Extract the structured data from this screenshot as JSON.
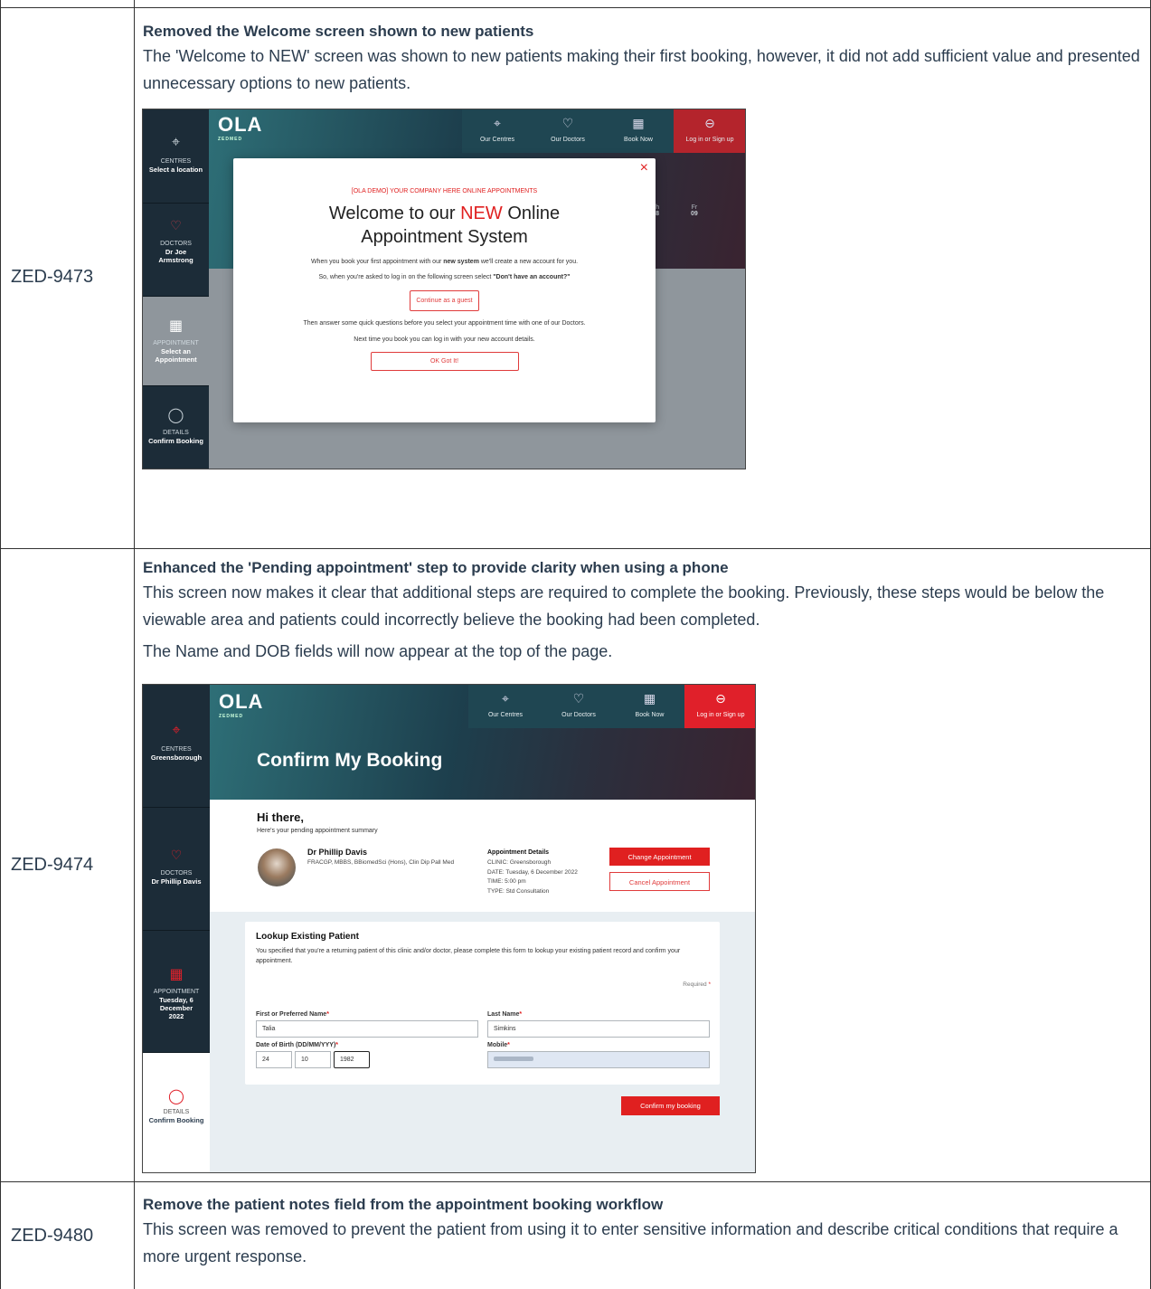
{
  "rows": [
    {
      "ticket": "ZED-9473",
      "heading": "Removed the Welcome screen shown to new patients",
      "paragraphs": [
        "The 'Welcome to NEW' screen was shown to new patients making their first booking, however, it did not add sufficient value and presented unnecessary options to new patients."
      ]
    },
    {
      "ticket": "ZED-9474",
      "heading": "Enhanced the 'Pending appointment' step to provide clarity when using a phone",
      "paragraphs": [
        "This screen now makes it clear that additional steps are required to complete the booking. Previously, these steps would be below the viewable area and patients could incorrectly believe the booking had been completed.",
        "The Name and DOB fields will now appear at the top of the page."
      ]
    },
    {
      "ticket": "ZED-9480",
      "heading": "Remove the patient notes field from the appointment booking workflow",
      "paragraphs": [
        "This screen was removed to prevent the patient from using it to enter sensitive information and describe critical conditions that require a more urgent response."
      ]
    }
  ],
  "shot1": {
    "logo": "OLA",
    "logo_sub": "ZEDMED",
    "nav": [
      "Our Centres",
      "Our Doctors",
      "Book Now",
      "Log in or Sign up"
    ],
    "steps": [
      {
        "label": "CENTRES",
        "value": "Select a location"
      },
      {
        "label": "DOCTORS",
        "value": "Dr Joe Armstrong"
      },
      {
        "label": "APPOINTMENT",
        "value": "Select an Appointment"
      },
      {
        "label": "DETAILS",
        "value": "Confirm Booking"
      }
    ],
    "days": [
      {
        "d": "Th",
        "n": "08"
      },
      {
        "d": "Fr",
        "n": "09"
      }
    ],
    "modal": {
      "company": "[OLA DEMO] YOUR COMPANY HERE ONLINE APPOINTMENTS",
      "title_pre": "Welcome to our ",
      "title_new": "NEW",
      "title_post": " Online",
      "title_line2": "Appointment System",
      "line1_pre": "When you book your first appointment with our ",
      "line1_bold": "new system",
      "line1_post": " we'll create a new account for you.",
      "line2_pre": "So, when you're asked to log in on the following screen select ",
      "line2_bold": "\"Don't have an account?\"",
      "guest_button": "Continue as a guest",
      "line3": "Then answer some quick questions before you select your appointment time with one of our Doctors.",
      "line4": "Next time you book you can log in with your new account details.",
      "ok_button": "OK Got It!"
    }
  },
  "shot2": {
    "logo": "OLA",
    "logo_sub": "ZEDMED",
    "nav": [
      "Our Centres",
      "Our Doctors",
      "Book Now",
      "Log in or Sign up"
    ],
    "hero_title": "Confirm My Booking",
    "steps": [
      {
        "label": "CENTRES",
        "value": "Greensborough"
      },
      {
        "label": "DOCTORS",
        "value": "Dr Phillip Davis"
      },
      {
        "label": "APPOINTMENT",
        "value": "Tuesday, 6 December 2022"
      },
      {
        "label": "DETAILS",
        "value": "Confirm Booking"
      }
    ],
    "greeting": "Hi there,",
    "greeting_sub": "Here's your pending appointment summary",
    "doctor_name": "Dr Phillip Davis",
    "doctor_quals": "FRACGP, MBBS, BBiomedSci (Hons), Clin Dip Pall Med",
    "appt_heading": "Appointment Details",
    "appt_lines": [
      "CLINIC: Greensborough",
      "DATE: Tuesday, 6 December 2022",
      "TIME: 5:00 pm",
      "TYPE: Std Consultation"
    ],
    "change_button": "Change Appointment",
    "cancel_button": "Cancel Appointment",
    "lookup_title": "Lookup Existing Patient",
    "lookup_desc": "You specified that you're a returning patient of this clinic and/or doctor, please complete this form to lookup your existing patient record and confirm your appointment.",
    "required": "Required",
    "first_name_label": "First or Preferred Name",
    "last_name_label": "Last Name",
    "dob_label": "Date of Birth (DD/MM/YYY)",
    "mobile_label": "Mobile",
    "first_name": "Talia",
    "last_name": "Simkins",
    "dob_d": "24",
    "dob_m": "10",
    "dob_y": "1982",
    "confirm_button": "Confirm my booking"
  }
}
